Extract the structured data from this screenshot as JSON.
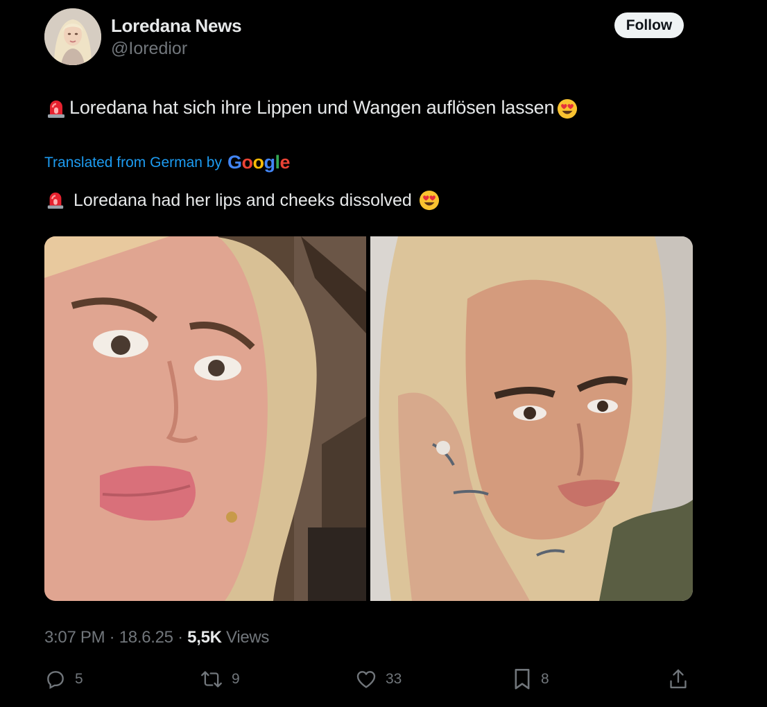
{
  "author": {
    "display_name": "Loredana News",
    "handle": "@Ioredior"
  },
  "follow_label": "Follow",
  "tweet": {
    "text": "Loredana hat sich ihre Lippen und Wangen auflösen lassen",
    "leading_icon": "siren-emoji",
    "trailing_icon": "heart-eyes-emoji"
  },
  "translation": {
    "label": "Translated from German by",
    "provider": "Google",
    "text": "Loredana had her lips and cheeks dissolved"
  },
  "media": {
    "count": 2,
    "descriptions": [
      "photo-left",
      "photo-right"
    ]
  },
  "meta": {
    "time": "3:07 PM",
    "separator": "·",
    "date": "18.6.25",
    "views_count": "5,5K",
    "views_label": "Views"
  },
  "actions": {
    "replies": "5",
    "reposts": "9",
    "likes": "33",
    "bookmarks": "8"
  },
  "colors": {
    "background": "#000000",
    "text": "#e7e9ea",
    "secondary": "#71767b",
    "link": "#1d9bf0"
  }
}
